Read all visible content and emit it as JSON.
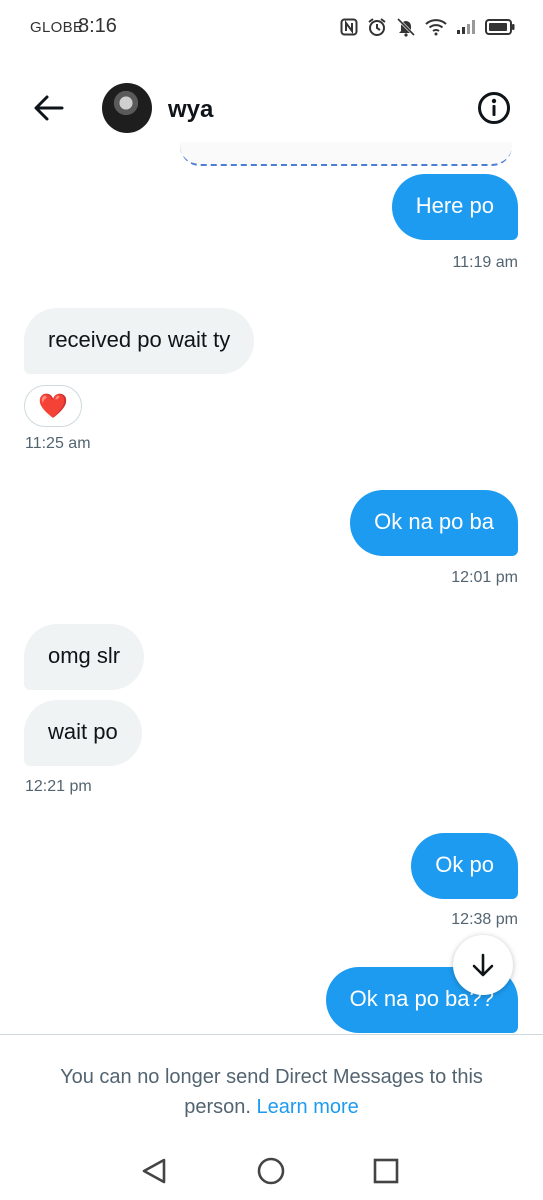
{
  "status_bar": {
    "carrier": "GLOBE",
    "time": "8:16"
  },
  "header": {
    "title": "wya"
  },
  "messages": [
    {
      "text": "Here po",
      "time": "11:19 am"
    },
    {
      "text": "received po wait ty",
      "time": "11:25 am",
      "reaction": "❤️"
    },
    {
      "text": "Ok na po ba",
      "time": "12:01 pm"
    },
    {
      "text": "omg slr"
    },
    {
      "text": "wait po",
      "time": "12:21 pm"
    },
    {
      "text": "Ok po",
      "time": "12:38 pm"
    },
    {
      "text": "Ok na po ba??"
    }
  ],
  "footer": {
    "notice": "You can no longer send Direct Messages to this person.",
    "link": "Learn more"
  },
  "colors": {
    "outgoing_bubble": "#1d9bf0",
    "incoming_bubble": "#eff3f4",
    "link": "#1d9bf0"
  },
  "icons": [
    "back-arrow-icon",
    "info-icon",
    "heart-icon",
    "arrow-down-icon",
    "nav-back-icon",
    "nav-home-icon",
    "nav-recents-icon"
  ]
}
